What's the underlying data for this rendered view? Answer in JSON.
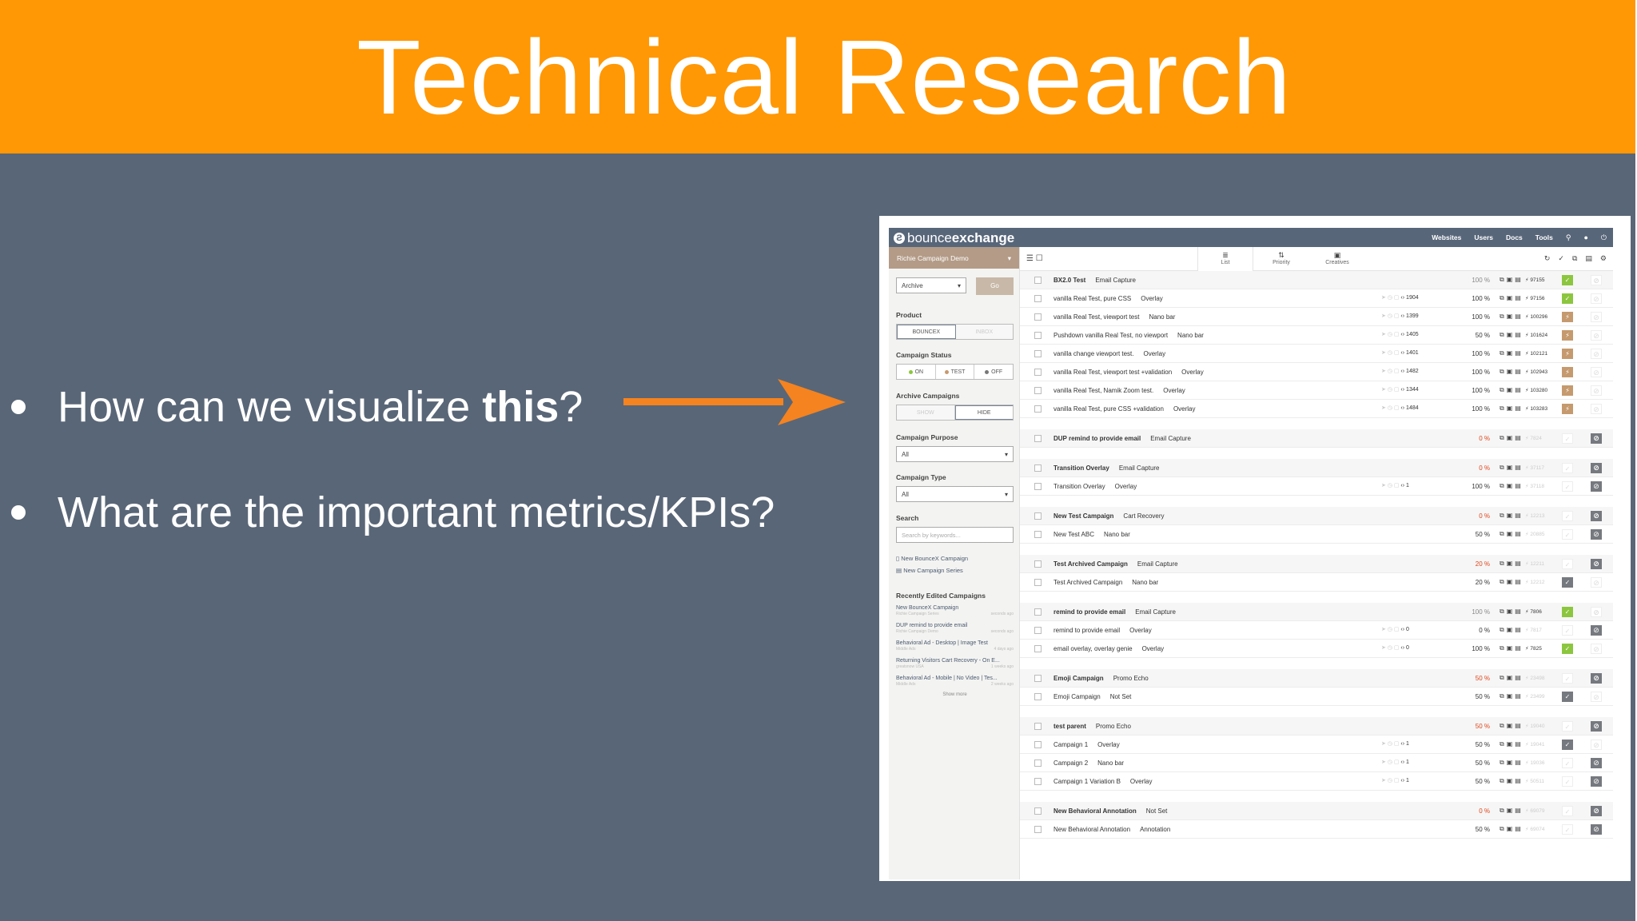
{
  "slide": {
    "title": "Technical Research",
    "bullets": [
      {
        "pre": "How can we visualize ",
        "bold": "this",
        "post": "?"
      },
      {
        "pre": "What are the important metrics/KPIs?",
        "bold": "",
        "post": ""
      }
    ],
    "colors": {
      "title_band": "#ff9804",
      "background": "#596677",
      "arrow": "#f5831f"
    }
  },
  "app": {
    "brand": {
      "light": "bounce",
      "bold": "exchange"
    },
    "topnav": [
      "Websites",
      "Users",
      "Docs",
      "Tools"
    ],
    "sidebar": {
      "account": "Richie Campaign Demo",
      "archive_select": "Archive",
      "go_label": "Go",
      "product_label": "Product",
      "product_options": [
        "BOUNCEX",
        "INBOX"
      ],
      "status_label": "Campaign Status",
      "status_options": [
        "ON",
        "TEST",
        "OFF"
      ],
      "archive_label": "Archive Campaigns",
      "archive_options": [
        "SHOW",
        "HIDE"
      ],
      "purpose_label": "Campaign Purpose",
      "purpose_value": "All",
      "type_label": "Campaign Type",
      "type_value": "All",
      "search_label": "Search",
      "search_placeholder": "Search by keywords...",
      "new_campaign": "New BounceX Campaign",
      "new_series": "New Campaign Series",
      "recent_label": "Recently Edited Campaigns",
      "recent": [
        {
          "name": "New BounceX Campaign",
          "sub": "Richie Campaign Series",
          "when": "seconds ago"
        },
        {
          "name": "DUP remind to provide email",
          "sub": "Richie Campaign Demo",
          "when": "seconds ago"
        },
        {
          "name": "Behavioral Ad - Desktop | Image Test",
          "sub": "Middle Ads",
          "when": "4 days ago"
        },
        {
          "name": "Returning Visitors Cart Recovery - On E...",
          "sub": "greatsnow USA",
          "when": "1 weeks ago"
        },
        {
          "name": "Behavioral Ad - Mobile | No Video | Tes...",
          "sub": "Middle Ads",
          "when": "2 weeks ago"
        }
      ],
      "show_more": "Show more"
    },
    "tabs": [
      "List",
      "Priority",
      "Creatives"
    ],
    "rows": [
      {
        "name": "BX2.0 Test",
        "type": "Email Capture",
        "parent": true,
        "gap": false,
        "icons": "",
        "pct": "100 %",
        "pct_color": "grey",
        "rid": "97155",
        "rid_faded": false,
        "st": "green",
        "cir": "none"
      },
      {
        "name": "vanilla Real Test, pure CSS",
        "type": "Overlay",
        "parent": false,
        "gap": false,
        "icons": "1904",
        "pct": "100 %",
        "pct_color": "",
        "rid": "97156",
        "rid_faded": false,
        "st": "green",
        "cir": "none"
      },
      {
        "name": "vanilla Real Test, viewport test",
        "type": "Nano bar",
        "parent": false,
        "gap": false,
        "icons": "1399",
        "pct": "100 %",
        "pct_color": "",
        "rid": "100296",
        "rid_faded": false,
        "st": "brown",
        "cir": "none"
      },
      {
        "name": "Pushdown vanilla Real Test, no viewport",
        "type": "Nano bar",
        "parent": false,
        "gap": false,
        "icons": "1405",
        "pct": "50 %",
        "pct_color": "",
        "rid": "101624",
        "rid_faded": false,
        "st": "brown",
        "cir": "none"
      },
      {
        "name": "vanilla change viewport test.",
        "type": "Overlay",
        "parent": false,
        "gap": false,
        "icons": "1401",
        "pct": "100 %",
        "pct_color": "",
        "rid": "102121",
        "rid_faded": false,
        "st": "brown",
        "cir": "none"
      },
      {
        "name": "vanilla Real Test, viewport test +validation",
        "type": "Overlay",
        "parent": false,
        "gap": false,
        "icons": "1482",
        "pct": "100 %",
        "pct_color": "",
        "rid": "102943",
        "rid_faded": false,
        "st": "brown",
        "cir": "none"
      },
      {
        "name": "vanilla Real Test, Namik Zoom test.",
        "type": "Overlay",
        "parent": false,
        "gap": false,
        "icons": "1344",
        "pct": "100 %",
        "pct_color": "",
        "rid": "103280",
        "rid_faded": false,
        "st": "brown",
        "cir": "none"
      },
      {
        "name": "vanilla Real Test, pure CSS +validation",
        "type": "Overlay",
        "parent": false,
        "gap": false,
        "icons": "1484",
        "pct": "100 %",
        "pct_color": "",
        "rid": "103283",
        "rid_faded": false,
        "st": "brown",
        "cir": "none"
      },
      {
        "name": "DUP remind to provide email",
        "type": "Email Capture",
        "parent": true,
        "gap": true,
        "icons": "",
        "pct": "0 %",
        "pct_color": "red",
        "rid": "7824",
        "rid_faded": true,
        "st": "none",
        "cir": "dark"
      },
      {
        "name": "Transition Overlay",
        "type": "Email Capture",
        "parent": true,
        "gap": true,
        "icons": "",
        "pct": "0 %",
        "pct_color": "red",
        "rid": "37117",
        "rid_faded": true,
        "st": "none",
        "cir": "dark"
      },
      {
        "name": "Transition Overlay",
        "type": "Overlay",
        "parent": false,
        "gap": false,
        "icons": "1",
        "pct": "100 %",
        "pct_color": "",
        "rid": "37118",
        "rid_faded": true,
        "st": "none",
        "cir": "dark"
      },
      {
        "name": "New Test Campaign",
        "type": "Cart Recovery",
        "parent": true,
        "gap": true,
        "icons": "",
        "pct": "0 %",
        "pct_color": "red",
        "rid": "12213",
        "rid_faded": true,
        "st": "none",
        "cir": "dark"
      },
      {
        "name": "New Test ABC",
        "type": "Nano bar",
        "parent": false,
        "gap": false,
        "icons": "",
        "pct": "50 %",
        "pct_color": "",
        "rid": "20885",
        "rid_faded": true,
        "st": "none",
        "cir": "dark"
      },
      {
        "name": "Test Archived Campaign",
        "type": "Email Capture",
        "parent": true,
        "gap": true,
        "icons": "",
        "pct": "20 %",
        "pct_color": "red",
        "rid": "12211",
        "rid_faded": true,
        "st": "none",
        "cir": "dark"
      },
      {
        "name": "Test Archived Campaign",
        "type": "Nano bar",
        "parent": false,
        "gap": false,
        "icons": "",
        "pct": "20 %",
        "pct_color": "",
        "rid": "12212",
        "rid_faded": true,
        "st": "gray",
        "cir": "none"
      },
      {
        "name": "remind to provide email",
        "type": "Email Capture",
        "parent": true,
        "gap": true,
        "icons": "",
        "pct": "100 %",
        "pct_color": "grey",
        "rid": "7806",
        "rid_faded": false,
        "st": "green",
        "cir": "none"
      },
      {
        "name": "remind to provide email",
        "type": "Overlay",
        "parent": false,
        "gap": false,
        "icons": "0",
        "pct": "0 %",
        "pct_color": "",
        "rid": "7817",
        "rid_faded": true,
        "st": "none",
        "cir": "dark"
      },
      {
        "name": "email overlay, overlay genie",
        "type": "Overlay",
        "parent": false,
        "gap": false,
        "icons": "0",
        "pct": "100 %",
        "pct_color": "",
        "rid": "7825",
        "rid_faded": false,
        "st": "green",
        "cir": "none"
      },
      {
        "name": "Emoji Campaign",
        "type": "Promo Echo",
        "parent": true,
        "gap": true,
        "icons": "",
        "pct": "50 %",
        "pct_color": "red",
        "rid": "23498",
        "rid_faded": true,
        "st": "none",
        "cir": "dark"
      },
      {
        "name": "Emoji Campaign",
        "type": "Not Set",
        "parent": false,
        "gap": false,
        "icons": "",
        "pct": "50 %",
        "pct_color": "",
        "rid": "23499",
        "rid_faded": true,
        "st": "gray",
        "cir": "none"
      },
      {
        "name": "test parent",
        "type": "Promo Echo",
        "parent": true,
        "gap": true,
        "icons": "",
        "pct": "50 %",
        "pct_color": "red",
        "rid": "19040",
        "rid_faded": true,
        "st": "none",
        "cir": "dark"
      },
      {
        "name": "Campaign 1",
        "type": "Overlay",
        "parent": false,
        "gap": false,
        "icons": "1",
        "pct": "50 %",
        "pct_color": "",
        "rid": "19041",
        "rid_faded": true,
        "st": "gray",
        "cir": "none"
      },
      {
        "name": "Campaign 2",
        "type": "Nano bar",
        "parent": false,
        "gap": false,
        "icons": "1",
        "pct": "50 %",
        "pct_color": "",
        "rid": "19036",
        "rid_faded": true,
        "st": "none",
        "cir": "dark"
      },
      {
        "name": "Campaign 1 Variation B",
        "type": "Overlay",
        "parent": false,
        "gap": false,
        "icons": "1",
        "pct": "50 %",
        "pct_color": "",
        "rid": "50511",
        "rid_faded": true,
        "st": "none",
        "cir": "dark"
      },
      {
        "name": "New Behavioral Annotation",
        "type": "Not Set",
        "parent": true,
        "gap": true,
        "icons": "",
        "pct": "0 %",
        "pct_color": "red",
        "rid": "69079",
        "rid_faded": true,
        "st": "none",
        "cir": "dark"
      },
      {
        "name": "New Behavioral Annotation",
        "type": "Annotation",
        "parent": false,
        "gap": false,
        "icons": "",
        "pct": "50 %",
        "pct_color": "",
        "rid": "69074",
        "rid_faded": true,
        "st": "none",
        "cir": "dark"
      }
    ]
  }
}
